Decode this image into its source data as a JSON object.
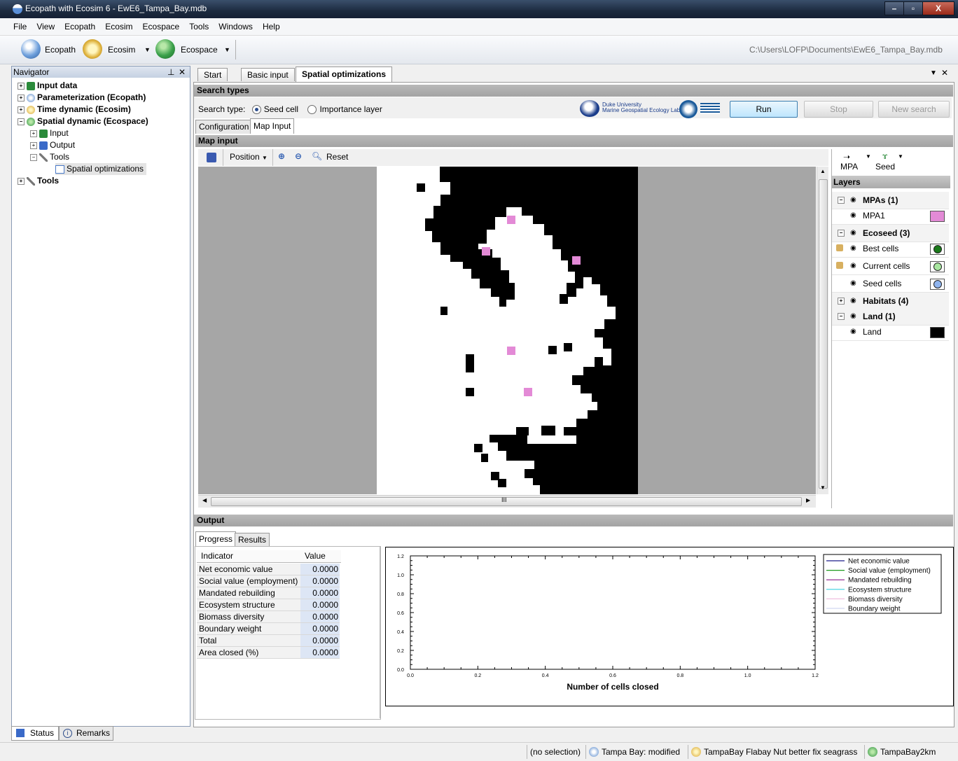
{
  "window": {
    "title": "Ecopath with Ecosim 6 - EwE6_Tampa_Bay.mdb"
  },
  "menu": [
    "File",
    "View",
    "Ecopath",
    "Ecosim",
    "Ecospace",
    "Tools",
    "Windows",
    "Help"
  ],
  "toolbar": {
    "ecopath": "Ecopath",
    "ecosim": "Ecosim",
    "ecospace": "Ecospace",
    "path": "C:\\Users\\LOFP\\Documents\\EwE6_Tampa_Bay.mdb"
  },
  "navigator": {
    "title": "Navigator",
    "items": [
      {
        "label": "Input data"
      },
      {
        "label": "Parameterization (Ecopath)"
      },
      {
        "label": "Time dynamic (Ecosim)"
      },
      {
        "label": "Spatial dynamic  (Ecospace)"
      },
      {
        "label": "Input"
      },
      {
        "label": "Output"
      },
      {
        "label": "Tools"
      },
      {
        "label": "Spatial optimizations"
      },
      {
        "label": "Tools"
      }
    ]
  },
  "tabs": [
    {
      "label": "Start"
    },
    {
      "label": "Basic input"
    },
    {
      "label": "Spatial optimizations"
    }
  ],
  "search": {
    "header": "Search types",
    "type_label": "Search type:",
    "options": [
      "Seed cell",
      "Importance layer"
    ],
    "selected": "Seed cell",
    "logo_line1": "Duke University",
    "logo_line2": "Marine Geospatial Ecology Lab",
    "buttons": {
      "run": "Run",
      "stop": "Stop",
      "new_search": "New search"
    }
  },
  "subtabs": [
    {
      "label": "Configuration"
    },
    {
      "label": "Map Input"
    }
  ],
  "map": {
    "header": "Map input",
    "toolbar": {
      "position": "Position",
      "reset": "Reset"
    },
    "scroll_mark": "III"
  },
  "layers": {
    "tools": {
      "mpa": "MPA",
      "seed": "Seed"
    },
    "title": "Layers",
    "rows": [
      {
        "label": "MPAs (1)",
        "group": true,
        "color": ""
      },
      {
        "label": "MPA1",
        "group": false,
        "color": "#e38ad6"
      },
      {
        "label": "Ecoseed (3)",
        "group": true,
        "color": ""
      },
      {
        "label": "Best cells",
        "group": false,
        "color": "#1a7a1a"
      },
      {
        "label": "Current cells",
        "group": false,
        "color": "#a8e6a0"
      },
      {
        "label": "Seed cells",
        "group": false,
        "color": "#8fb4ee"
      },
      {
        "label": "Habitats (4)",
        "group": true,
        "color": ""
      },
      {
        "label": "Land (1)",
        "group": true,
        "color": ""
      },
      {
        "label": "Land",
        "group": false,
        "color": "#000000"
      }
    ]
  },
  "output": {
    "header": "Output",
    "tabs": [
      "Progress",
      "Results"
    ],
    "table": {
      "columns": [
        "Indicator",
        "Value"
      ],
      "rows": [
        [
          "Net economic value",
          "0.0000"
        ],
        [
          "Social value (employment)",
          "0.0000"
        ],
        [
          "Mandated rebuilding",
          "0.0000"
        ],
        [
          "Ecosystem structure",
          "0.0000"
        ],
        [
          "Biomass diversity",
          "0.0000"
        ],
        [
          "Boundary weight",
          "0.0000"
        ],
        [
          "Total",
          "0.0000"
        ],
        [
          "Area closed (%)",
          "0.0000"
        ]
      ]
    }
  },
  "chart_data": {
    "type": "line",
    "xlabel": "Number of cells closed",
    "xlim": [
      0,
      1.2
    ],
    "ylim": [
      0,
      1.2
    ],
    "xticks": [
      "0.0",
      "0.2",
      "0.4",
      "0.6",
      "0.8",
      "1.0",
      "1.2"
    ],
    "yticks": [
      "0.0",
      "0.2",
      "0.4",
      "0.6",
      "0.8",
      "1.0",
      "1.2"
    ],
    "series": [
      {
        "name": "Net economic value",
        "color": "#1c1c8a",
        "values": []
      },
      {
        "name": "Social value (employment)",
        "color": "#1f9a1f",
        "values": []
      },
      {
        "name": "Mandated rebuilding",
        "color": "#8a1a8a",
        "values": []
      },
      {
        "name": "Ecosystem structure",
        "color": "#3ad0e0",
        "values": []
      },
      {
        "name": "Biomass diversity",
        "color": "#f0c0e0",
        "values": []
      },
      {
        "name": "Boundary weight",
        "color": "#d0d8f0",
        "values": []
      }
    ],
    "legend": "top-right"
  },
  "bottom_tabs": [
    "Status",
    "Remarks"
  ],
  "status": [
    "(no selection)",
    "Tampa Bay: modified",
    "TampaBay Flabay Nut better fix seagrass",
    "TampaBay2km"
  ]
}
